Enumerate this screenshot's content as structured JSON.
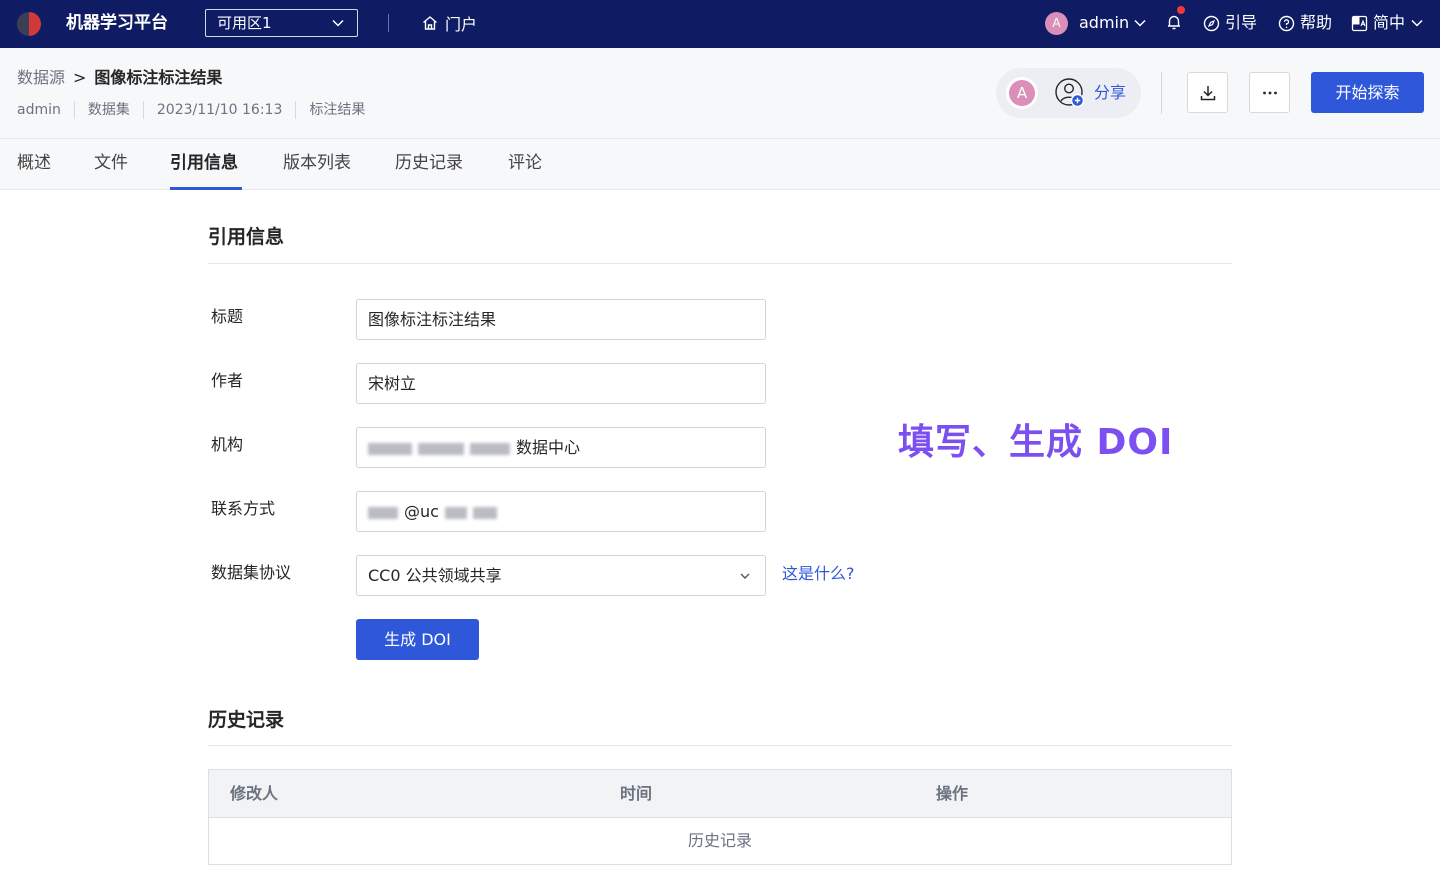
{
  "topnav": {
    "brand": "机器学习平台",
    "zone": "可用区1",
    "portal": "门户",
    "user_initial": "A",
    "username": "admin",
    "guide": "引导",
    "help": "帮助",
    "language": "简中"
  },
  "header": {
    "breadcrumb_root": "数据源",
    "breadcrumb_sep": ">",
    "breadcrumb_current": "图像标注标注结果",
    "meta": [
      "admin",
      "数据集",
      "2023/11/10 16:13",
      "标注结果"
    ],
    "share_initial": "A",
    "share_label": "分享",
    "explore_label": "开始探索"
  },
  "tabs": [
    "概述",
    "文件",
    "引用信息",
    "版本列表",
    "历史记录",
    "评论"
  ],
  "active_tab": "引用信息",
  "citation": {
    "section_title": "引用信息",
    "fields": {
      "title_label": "标题",
      "title_value": "图像标注标注结果",
      "author_label": "作者",
      "author_value": "宋树立",
      "org_label": "机构",
      "org_value_suffix": "数据中心",
      "contact_label": "联系方式",
      "contact_value_fragment": "@uc",
      "license_label": "数据集协议",
      "license_value": "CC0 公共领域共享"
    },
    "help_link": "这是什么?",
    "generate_button": "生成 DOI",
    "annotation": "填写、生成 DOI"
  },
  "history": {
    "section_title": "历史记录",
    "columns": [
      "修改人",
      "时间",
      "操作"
    ],
    "empty_text": "历史记录"
  },
  "colors": {
    "nav_bg": "#0f1c63",
    "accent": "#2f57d9",
    "annotation": "#7b4ff0",
    "notification_dot": "#f03838"
  }
}
